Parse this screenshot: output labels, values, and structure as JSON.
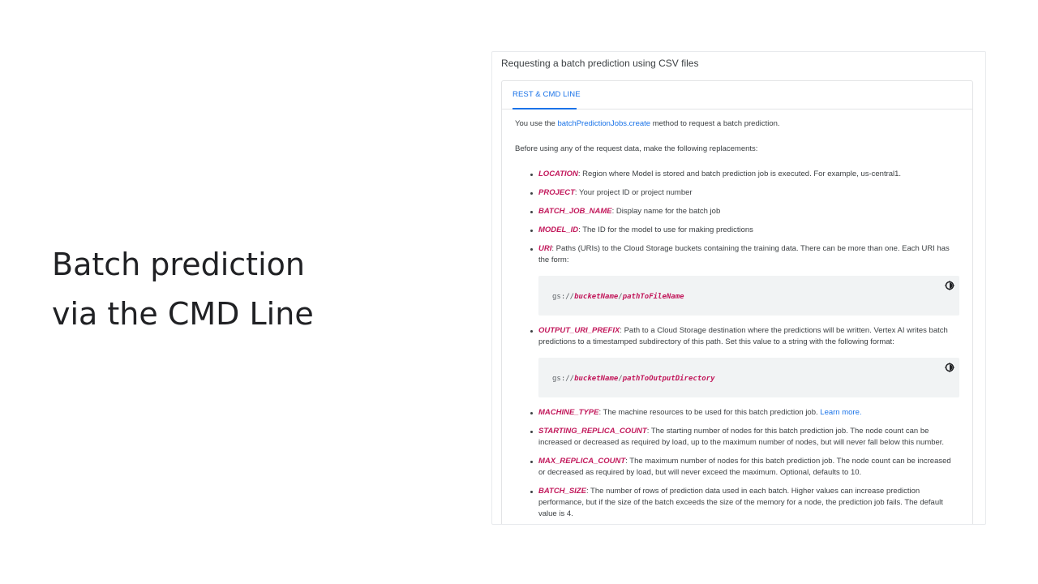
{
  "slide": {
    "title_line1": "Batch prediction",
    "title_line2": "via the CMD Line"
  },
  "doc": {
    "heading": "Requesting a batch prediction using CSV files",
    "tab_label": "REST & CMD LINE",
    "intro_prefix": "You use the ",
    "intro_link": "batchPredictionJobs.create",
    "intro_suffix": " method to request a batch prediction.",
    "replacements_intro": "Before using any of the request data, make the following replacements:",
    "params": [
      {
        "name": "LOCATION",
        "desc": ": Region where Model is stored and batch prediction job is executed. For example, us-central1."
      },
      {
        "name": "PROJECT",
        "desc": ": Your project ID or project number"
      },
      {
        "name": "BATCH_JOB_NAME",
        "desc": ": Display name for the batch job"
      },
      {
        "name": "MODEL_ID",
        "desc": ": The ID for the model to use for making predictions"
      },
      {
        "name": "URI",
        "desc": ": Paths (URIs) to the Cloud Storage buckets containing the training data. There can be more than one. Each URI has the form:"
      },
      {
        "name": "OUTPUT_URI_PREFIX",
        "desc": ": Path to a Cloud Storage destination where the predictions will be written. Vertex AI writes batch predictions to a timestamped subdirectory of this path. Set this value to a string with the following format:"
      },
      {
        "name": "MACHINE_TYPE",
        "desc": ": The machine resources to be used for this batch prediction job. ",
        "link": "Learn more."
      },
      {
        "name": "STARTING_REPLICA_COUNT",
        "desc": ": The starting number of nodes for this batch prediction job. The node count can be increased or decreased as required by load, up to the maximum number of nodes, but will never fall below this number."
      },
      {
        "name": "MAX_REPLICA_COUNT",
        "desc": ": The maximum number of nodes for this batch prediction job. The node count can be increased or decreased as required by load, but will never exceed the maximum. Optional, defaults to 10."
      },
      {
        "name": "BATCH_SIZE",
        "desc": ": The number of rows of prediction data used in each batch. Higher values can increase prediction performance, but if the size of the batch exceeds the size of the memory for a node, the prediction job fails. The default value is 4."
      }
    ],
    "code1": {
      "prefix": "gs://",
      "var1": "bucketName",
      "sep": "/",
      "var2": "pathToFileName"
    },
    "code2": {
      "prefix": "gs://",
      "var1": "bucketName",
      "sep": "/",
      "var2": "pathToOutputDirectory"
    },
    "icons": {
      "theme_toggle": "dark-mode-toggle-icon"
    },
    "colors": {
      "link": "#1a73e8",
      "param": "#c2185b",
      "code_bg": "#f1f3f4"
    }
  }
}
